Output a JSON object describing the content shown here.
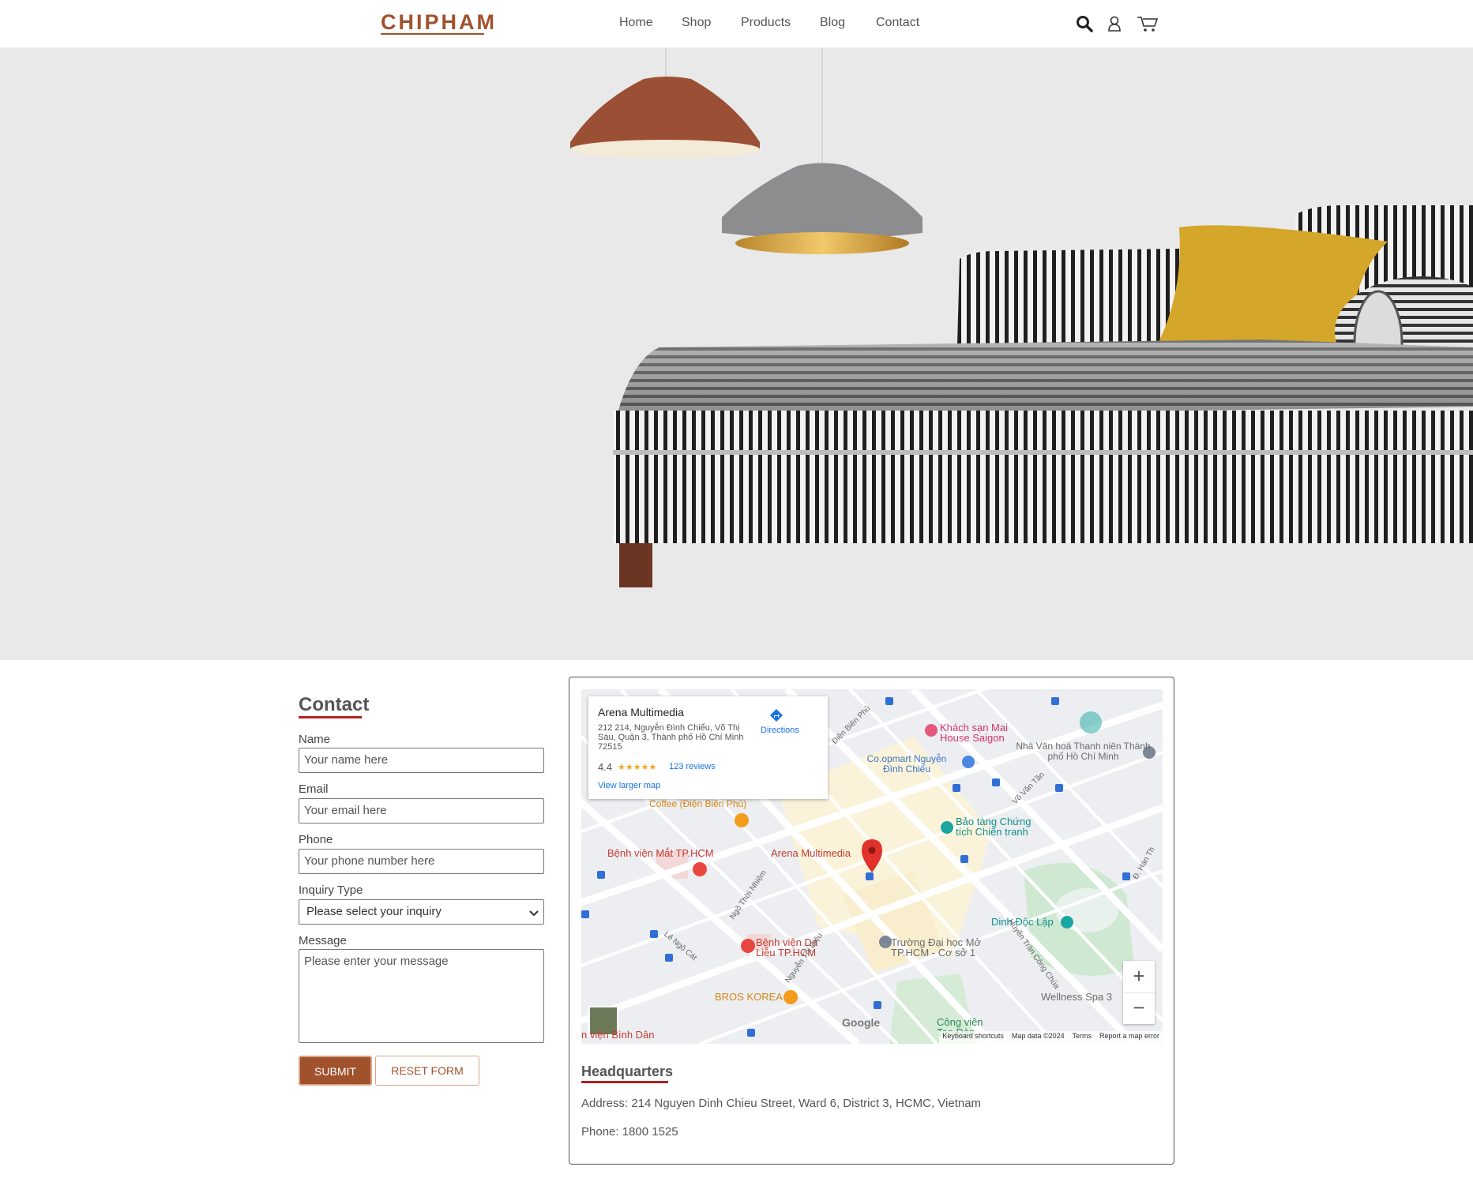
{
  "header": {
    "logo": "CHIPHAM",
    "nav": [
      "Home",
      "Shop",
      "Products",
      "Blog",
      "Contact"
    ],
    "icons": [
      "search-icon",
      "user-icon",
      "cart-icon"
    ]
  },
  "contact": {
    "title": "Contact",
    "fields": [
      {
        "label": "Name",
        "placeholder": "Your name here"
      },
      {
        "label": "Email",
        "placeholder": "Your email here"
      },
      {
        "label": "Phone",
        "placeholder": "Your phone number here"
      },
      {
        "label": "Inquiry Type",
        "placeholder": "Please select your inquiry"
      },
      {
        "label": "Message",
        "placeholder": "Please enter your message"
      }
    ],
    "submit": "SUBMIT",
    "reset": "RESET FORM"
  },
  "map": {
    "place_name": "Arena Multimedia",
    "place_address": "212 214, Nguyễn Đình Chiểu, Võ Thị Sáu, Quận 3, Thành phố Hồ Chí Minh 72515",
    "rating": "4.4",
    "stars": "★★★★★",
    "reviews": "123 reviews",
    "directions": "Directions",
    "larger_map": "View larger map",
    "labels": {
      "hotel": "Khách sạn Mai House Saigon",
      "coopmart": "Co.opmart Nguyễn Đình Chiểu",
      "nha_van_hoa": "Nhà Văn hoá Thanh niên Thành phố Hồ Chí Minh",
      "coffee": "Coffee (Điện Biên Phủ)",
      "benh_vien_mat": "Bệnh viện Mắt TP.HCM",
      "arena_pin": "Arena Multimedia",
      "bao_tang": "Bảo tàng Chứng tích Chiến tranh",
      "dinh_doc_lap": "Dinh Độc Lập",
      "da_lieu": "Bệnh viện Da Liễu TP.HCM",
      "truong_dh": "Trường Đại học Mở TP.HCM - Cơ sở 1",
      "bros_korea": "BROS KOREA",
      "wellness": "Wellness Spa 3",
      "cong_vien": "Công viên Tao Đàn",
      "binh_dan": "n viện Bình Dân",
      "google": "Google",
      "st_dien_bien_phu": "Điện Biên Phủ",
      "st_vo_van_tan": "Võ Văn Tần",
      "st_ngo_thoi_nhiem": "Ngô Thời Nhiệm",
      "st_le_ngo_cat": "Lê Ngô Cát",
      "st_nguyen_thi_dieu": "Nguyễn Thị Diệu",
      "st_huyen_tran": "Huyền Trân Công Chúa",
      "st_han_thuyen": "Đ. Hàn Th"
    },
    "footer": [
      "Keyboard shortcuts",
      "Map data ©2024",
      "Terms",
      "Report a map error"
    ],
    "zoom_in": "+",
    "zoom_out": "−"
  },
  "headquarters": {
    "title": "Headquarters",
    "address": "Address: 214 Nguyen Dinh Chieu Street, Ward 6, District 3, HCMC, Vietnam",
    "phone": "Phone: 1800 1525"
  },
  "colors": {
    "brand": "#a0522d",
    "underline": "#b22222",
    "pillow": "#d9a92a"
  }
}
